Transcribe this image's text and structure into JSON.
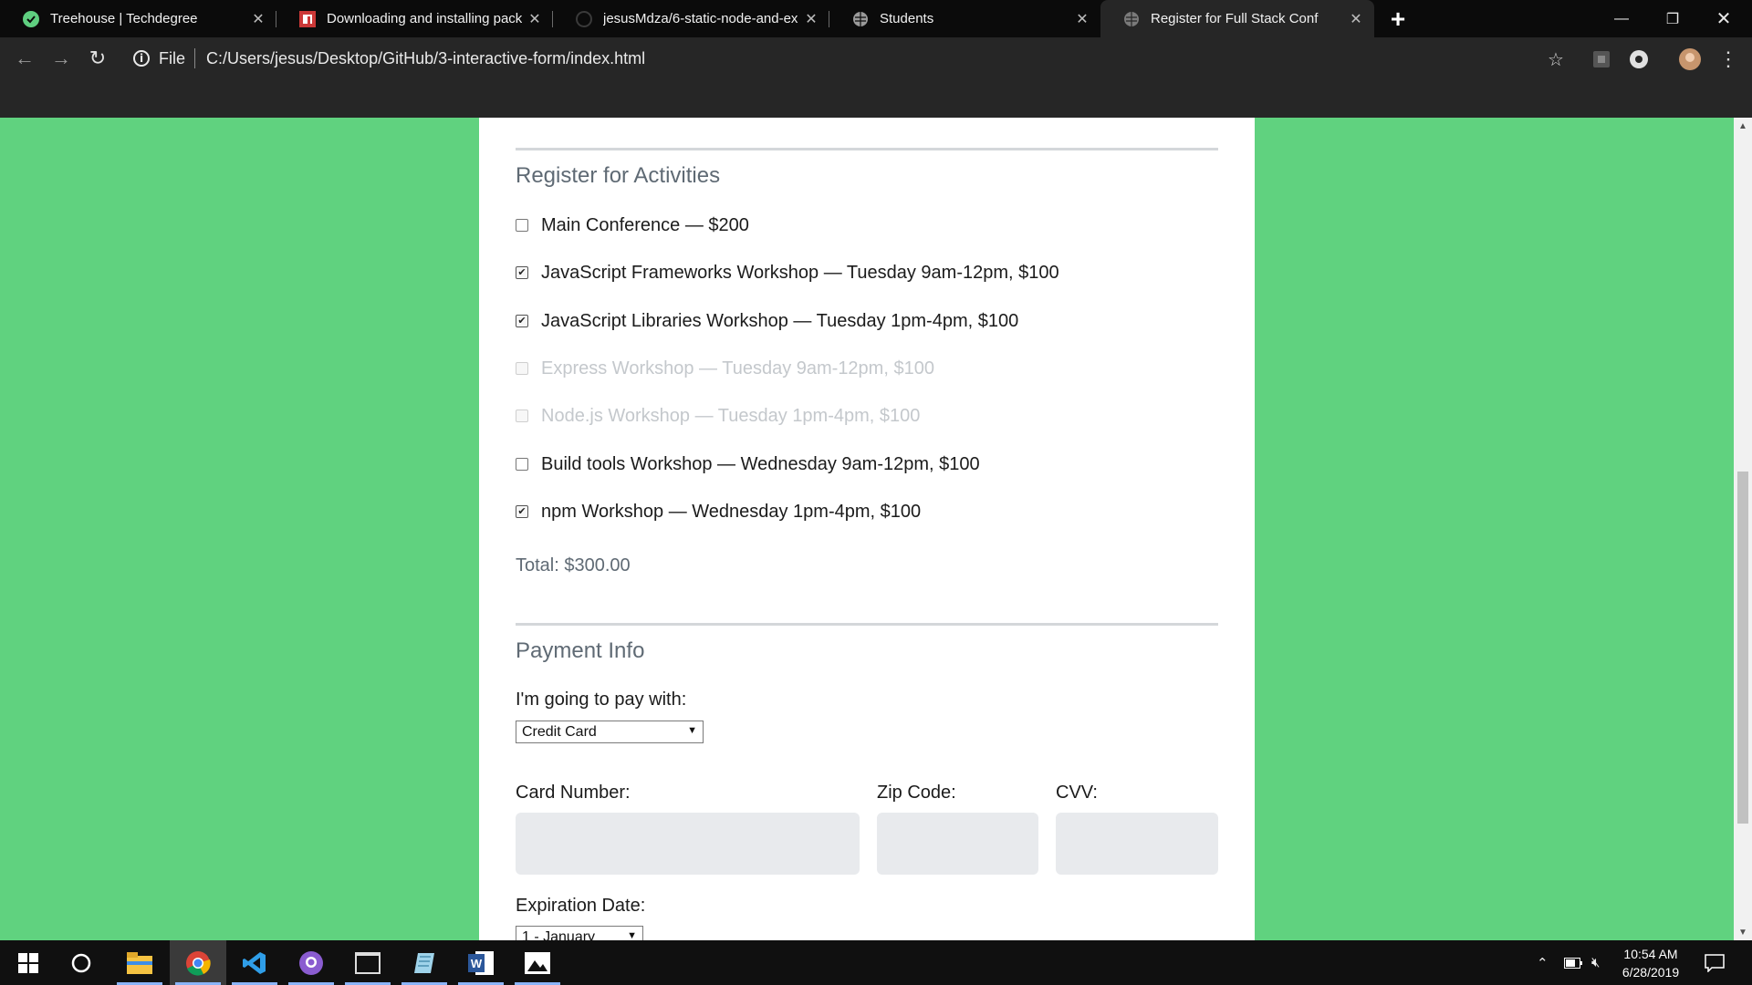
{
  "browser": {
    "tabs": [
      {
        "title": "Treehouse | Techdegree",
        "icon": "treehouse-icon"
      },
      {
        "title": "Downloading and installing pack",
        "icon": "npm-icon"
      },
      {
        "title": "jesusMdza/6-static-node-and-ex",
        "icon": "github-icon"
      },
      {
        "title": "Students",
        "icon": "globe-icon"
      },
      {
        "title": "Register for Full Stack Conf",
        "icon": "globe-icon"
      }
    ],
    "address": {
      "scheme_label": "File",
      "url": "C:/Users/jesus/Desktop/GitHub/3-interactive-form/index.html"
    }
  },
  "page": {
    "activities_legend": "Register for Activities",
    "activities": [
      {
        "label": "Main Conference — $200",
        "checked": false,
        "disabled": false
      },
      {
        "label": "JavaScript Frameworks Workshop — Tuesday 9am-12pm, $100",
        "checked": true,
        "disabled": false
      },
      {
        "label": "JavaScript Libraries Workshop — Tuesday 1pm-4pm, $100",
        "checked": true,
        "disabled": false
      },
      {
        "label": "Express Workshop — Tuesday 9am-12pm, $100",
        "checked": false,
        "disabled": true
      },
      {
        "label": "Node.js Workshop — Tuesday 1pm-4pm, $100",
        "checked": false,
        "disabled": true
      },
      {
        "label": "Build tools Workshop — Wednesday 9am-12pm, $100",
        "checked": false,
        "disabled": false
      },
      {
        "label": "npm Workshop — Wednesday 1pm-4pm, $100",
        "checked": true,
        "disabled": false
      }
    ],
    "total": "Total: $300.00",
    "payment_legend": "Payment Info",
    "pay_with_label": "I'm going to pay with:",
    "payment_method": "Credit Card",
    "card_number_label": "Card Number:",
    "zip_label": "Zip Code:",
    "cvv_label": "CVV:",
    "expiration_label": "Expiration Date:",
    "exp_month": "1 - January"
  },
  "taskbar": {
    "apps": [
      "start-icon",
      "search-icon",
      "file-explorer-icon",
      "chrome-icon",
      "vscode-icon",
      "github-desktop-icon",
      "terminal-icon",
      "notes-icon",
      "word-icon",
      "photos-icon"
    ],
    "time": "10:54 AM",
    "date": "6/28/2019"
  },
  "colors": {
    "page_background": "#60d27f",
    "card": "#ffffff",
    "legend": "#5f6a74",
    "input_fill": "#e8eaed"
  }
}
